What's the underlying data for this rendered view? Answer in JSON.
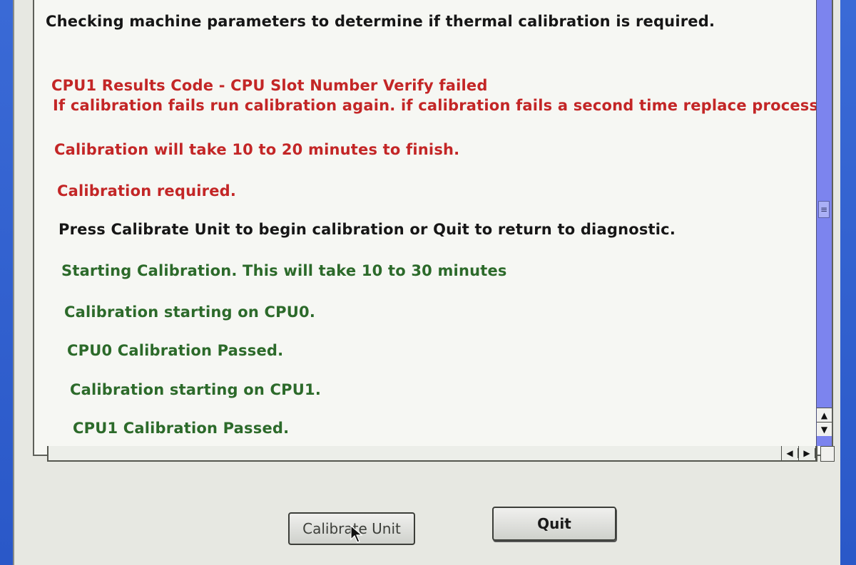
{
  "log": {
    "lines": [
      {
        "text": "Checking machine parameters to determine if thermal calibration is required.",
        "color": "#161616"
      },
      {
        "text": "CPU1 Results Code - CPU Slot Number Verify failed",
        "color": "#c32626"
      },
      {
        "text": "If calibration fails run calibration again. if calibration fails a second time replace processor.",
        "color": "#c32626"
      },
      {
        "text": "Calibration will take 10 to 20 minutes to finish.",
        "color": "#c32626"
      },
      {
        "text": "Calibration required.",
        "color": "#c32626"
      },
      {
        "text": "Press Calibrate Unit to begin calibration or Quit to return to diagnostic.",
        "color": "#161616"
      },
      {
        "text": "Starting Calibration. This will take 10 to 30 minutes",
        "color": "#2c6a2a"
      },
      {
        "text": "Calibration starting on CPU0.",
        "color": "#2c6a2a"
      },
      {
        "text": "CPU0 Calibration Passed.",
        "color": "#2c6a2a"
      },
      {
        "text": "Calibration starting on CPU1.",
        "color": "#2c6a2a"
      },
      {
        "text": "CPU1 Calibration Passed.",
        "color": "#2c6a2a"
      }
    ]
  },
  "buttons": {
    "calibrate_label": "Calibrate Unit",
    "quit_label": "Quit"
  },
  "icons": {
    "scroll_up": "▲",
    "scroll_down": "▼",
    "scroll_left": "◀",
    "scroll_right": "▶",
    "thumb_grip": "≡"
  },
  "colors": {
    "error": "#c32626",
    "success": "#2c6a2a",
    "normal": "#161616",
    "scrollbar": "#7c84ee"
  }
}
